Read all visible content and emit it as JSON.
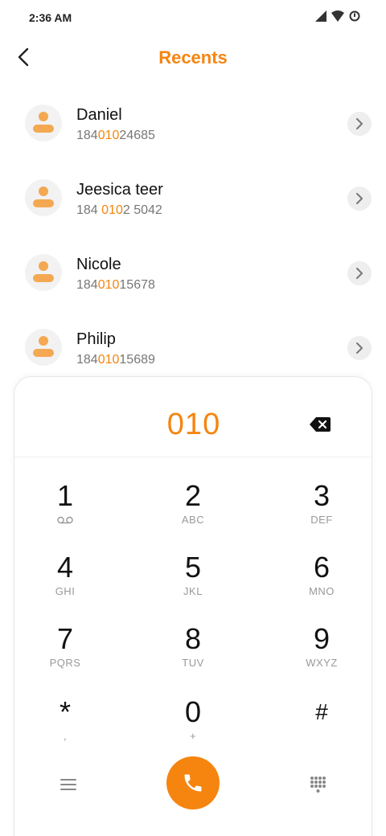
{
  "status": {
    "time": "2:36 AM"
  },
  "header": {
    "title": "Recents"
  },
  "contacts": [
    {
      "name": "Daniel",
      "number_pre": "184",
      "number_hl": "010",
      "number_post": "24685"
    },
    {
      "name": "Jeesica teer",
      "number_pre": "184 ",
      "number_hl": "010",
      "number_post": "2 5042"
    },
    {
      "name": "Nicole",
      "number_pre": "184",
      "number_hl": "010",
      "number_post": "15678"
    },
    {
      "name": "Philip",
      "number_pre": "184",
      "number_hl": "010",
      "number_post": "15689"
    }
  ],
  "dialer": {
    "entered": "010",
    "keys": [
      {
        "digit": "1",
        "letters": ""
      },
      {
        "digit": "2",
        "letters": "ABC"
      },
      {
        "digit": "3",
        "letters": "DEF"
      },
      {
        "digit": "4",
        "letters": "GHI"
      },
      {
        "digit": "5",
        "letters": "JKL"
      },
      {
        "digit": "6",
        "letters": "MNO"
      },
      {
        "digit": "7",
        "letters": "PQRS"
      },
      {
        "digit": "8",
        "letters": "TUV"
      },
      {
        "digit": "9",
        "letters": "WXYZ"
      },
      {
        "digit": "*",
        "letters": ","
      },
      {
        "digit": "0",
        "letters": "+"
      },
      {
        "digit": "#",
        "letters": ""
      }
    ]
  },
  "colors": {
    "accent": "#f5850f",
    "avatar": "#f4a852"
  },
  "icons": {
    "back": "chevron-left-icon",
    "backspace": "backspace-icon",
    "voicemail": "voicemail-icon",
    "menu": "menu-icon",
    "call": "phone-icon",
    "keypad": "dialpad-icon"
  }
}
